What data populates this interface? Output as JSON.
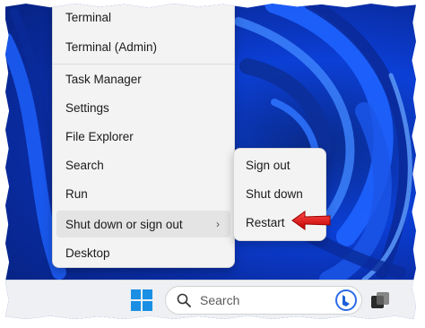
{
  "context_menu": {
    "items": [
      {
        "label": "Terminal"
      },
      {
        "label": "Terminal (Admin)"
      },
      {
        "label": "Task Manager"
      },
      {
        "label": "Settings"
      },
      {
        "label": "File Explorer"
      },
      {
        "label": "Search"
      },
      {
        "label": "Run"
      },
      {
        "label": "Shut down or sign out",
        "has_submenu": true
      },
      {
        "label": "Desktop"
      }
    ]
  },
  "submenu": {
    "items": [
      {
        "label": "Sign out"
      },
      {
        "label": "Shut down"
      },
      {
        "label": "Restart"
      }
    ]
  },
  "taskbar": {
    "search_placeholder": "Search"
  },
  "colors": {
    "arrow": "#e01010",
    "menu_bg": "#f3f3f3",
    "hover_bg": "#e4e4e4",
    "wallpaper": "#0b3fd6"
  },
  "icons": [
    "windows-start-icon",
    "search-icon",
    "bing-chat-icon",
    "task-view-icon",
    "chevron-right-icon",
    "red-arrow-icon"
  ]
}
